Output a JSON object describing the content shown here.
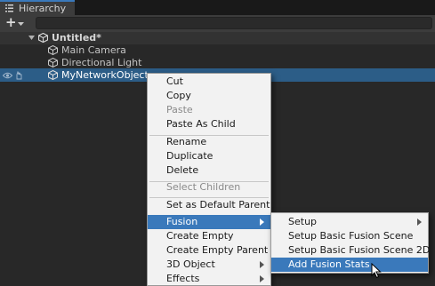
{
  "window": {
    "tab_title": "Hierarchy",
    "tab_icon": "list-icon"
  },
  "toolbar": {
    "add_button": "+",
    "search_placeholder": ""
  },
  "hierarchy": {
    "scene_name": "Untitled*",
    "items": [
      {
        "label": "Main Camera",
        "icon": "cube-icon"
      },
      {
        "label": "Directional Light",
        "icon": "cube-icon"
      },
      {
        "label": "MyNetworkObject",
        "icon": "cube-icon",
        "selected": true
      }
    ]
  },
  "context_menu": {
    "items": [
      {
        "label": "Cut"
      },
      {
        "label": "Copy"
      },
      {
        "label": "Paste",
        "disabled": true
      },
      {
        "label": "Paste As Child"
      },
      {
        "label": "Rename"
      },
      {
        "label": "Duplicate"
      },
      {
        "label": "Delete"
      },
      {
        "label": "Select Children",
        "disabled": true
      },
      {
        "label": "Set as Default Parent"
      },
      {
        "label": "Fusion",
        "highlighted": true,
        "submenu": true
      },
      {
        "label": "Create Empty"
      },
      {
        "label": "Create Empty Parent"
      },
      {
        "label": "3D Object",
        "submenu": true
      },
      {
        "label": "Effects",
        "submenu": true
      }
    ]
  },
  "fusion_submenu": {
    "items": [
      {
        "label": "Setup",
        "submenu": true
      },
      {
        "label": "Setup Basic Fusion Scene"
      },
      {
        "label": "Setup Basic Fusion Scene 2D"
      },
      {
        "label": "Add Fusion Stats",
        "highlighted": true
      }
    ]
  },
  "colors": {
    "selection": "#2c5d87",
    "menu_highlight": "#3a79bb",
    "menu_background": "#f2f2f2"
  }
}
